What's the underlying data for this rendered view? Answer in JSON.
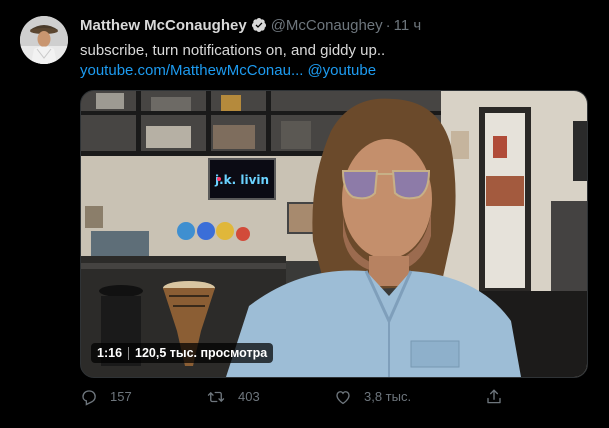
{
  "tweet": {
    "author_name": "Matthew McConaughey",
    "handle": "@McConaughey",
    "separator": "·",
    "time": "11 ч",
    "text": "subscribe, turn notifications on, and giddy up..",
    "link_url": "youtube.com/MatthewMcConau...",
    "mention": "@youtube"
  },
  "video": {
    "duration": "1:16",
    "views": "120,5 тыс. просмотра",
    "led_sign_text": "j.k. livin"
  },
  "actions": {
    "reply_count": "157",
    "retweet_count": "403",
    "like_count": "3,8 тыс."
  },
  "icons": {
    "verified": "verified-badge-icon",
    "reply": "reply-icon",
    "retweet": "retweet-icon",
    "like": "heart-icon",
    "share": "share-icon"
  },
  "colors": {
    "background": "#000000",
    "text": "#d9d9d9",
    "muted": "#6e767d",
    "link": "#1d9bf0",
    "border": "#2f3336"
  }
}
